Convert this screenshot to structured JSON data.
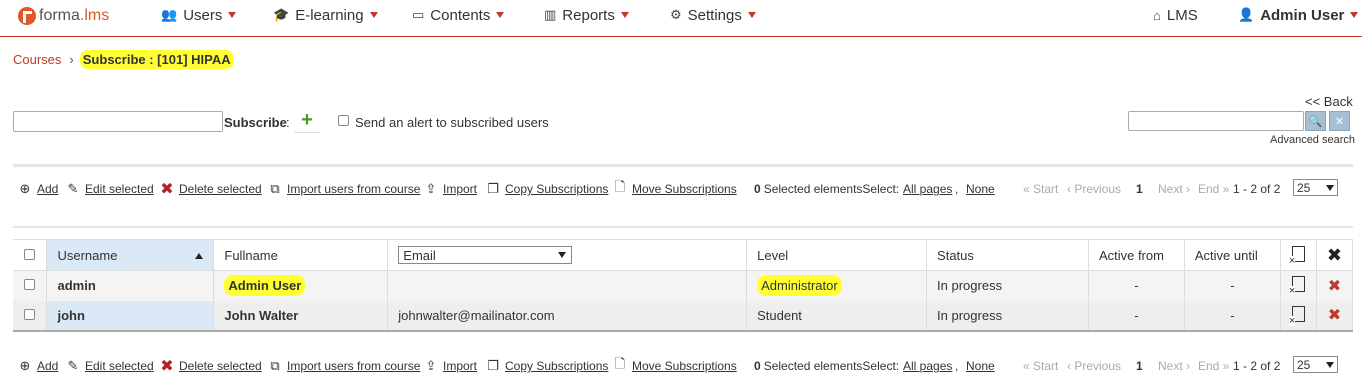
{
  "nav": {
    "logo_part1": "forma",
    "logo_part2": ".lms",
    "items": [
      {
        "label": "Users",
        "icon": "users-icon"
      },
      {
        "label": "E-learning",
        "icon": "graduation-cap-icon"
      },
      {
        "label": "Contents",
        "icon": "folder-icon"
      },
      {
        "label": "Reports",
        "icon": "bar-chart-icon"
      },
      {
        "label": "Settings",
        "icon": "cogs-icon"
      }
    ],
    "lms_label": "LMS",
    "user_label": "Admin User"
  },
  "breadcrumb": {
    "parent": "Courses",
    "separator": "›",
    "current": "Subscribe : [101] HIPAA"
  },
  "subscribe": {
    "back_label": "<< Back",
    "label": "Subscribe",
    "colon": ":",
    "alert_label": "Send an alert to subscribed users",
    "search_placeholder": "",
    "advanced_search": "Advanced search"
  },
  "toolbar": {
    "add": "Add",
    "edit_selected": "Edit selected",
    "delete_selected": "Delete selected",
    "import_from_course": "Import users from course",
    "import": "Import",
    "copy_subscriptions": "Copy Subscriptions",
    "move_subscriptions": "Move Subscriptions",
    "selected_count": "0",
    "selected_label": "Selected elements",
    "select_label": "Select:",
    "all_pages": "All pages",
    "comma": ",",
    "none": "None",
    "start": "« Start",
    "previous": "‹ Previous",
    "page": "1",
    "next": "Next ›",
    "end": "End »",
    "range": "1 - 2 of 2",
    "page_size": "25"
  },
  "table": {
    "headers": {
      "username": "Username",
      "fullname": "Fullname",
      "email_select": "Email",
      "level": "Level",
      "status": "Status",
      "active_from": "Active from",
      "active_until": "Active until"
    },
    "rows": [
      {
        "username": "admin",
        "fullname": "Admin User",
        "email": "",
        "level": "Administrator",
        "status": "In progress",
        "active_from": "-",
        "active_until": "-"
      },
      {
        "username": "john",
        "fullname": "John Walter",
        "email": "johnwalter@mailinator.com",
        "level": "Student",
        "status": "In progress",
        "active_from": "-",
        "active_until": "-"
      }
    ]
  },
  "colors": {
    "accent": "#c0392b",
    "highlight": "#ffff33",
    "logo": "#e0572a"
  }
}
